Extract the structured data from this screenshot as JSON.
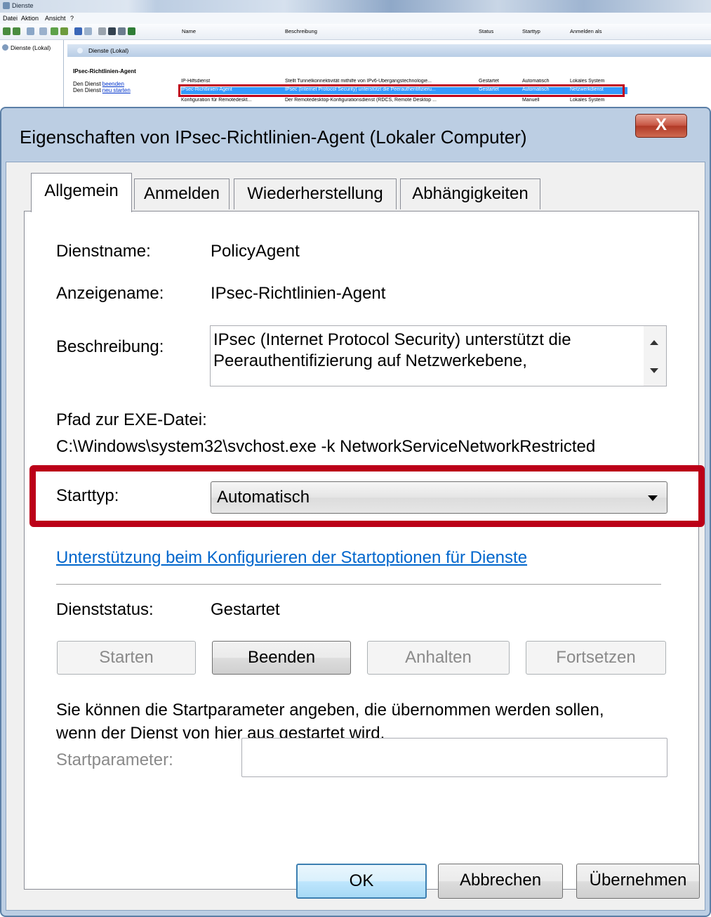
{
  "console": {
    "title": "Dienste",
    "menu": [
      "Datei",
      "Aktion",
      "Ansicht",
      "?"
    ],
    "tree_item": "Dienste (Lokal)",
    "pane_header": "Dienste (Lokal)",
    "detail": {
      "service_name": "IPsec-Richtlinien-Agent",
      "stop_prefix": "Den Dienst ",
      "stop_link": "beenden",
      "restart_prefix": "Den Dienst ",
      "restart_link": "neu starten"
    },
    "columns": [
      "Name",
      "Beschreibung",
      "Status",
      "Starttyp",
      "Anmelden als"
    ],
    "rows": [
      {
        "name": "IP-Hilfsdienst",
        "desc": "Stellt Tunnelkonnektivität mithilfe von IPv6-Übergangstechnologie...",
        "status": "Gestartet",
        "start": "Automatisch",
        "logon": "Lokales System"
      },
      {
        "name": "IPsec-Richtlinien-Agent",
        "desc": "IPsec (Internet Protocol Security) unterstützt die Peerauthentifizieru...",
        "status": "Gestartet",
        "start": "Automatisch",
        "logon": "Netzwerkdienst"
      },
      {
        "name": "Konfiguration für Remotedeskt...",
        "desc": "Der Remotedesktop-Konfigurationsdienst (RDCS, Remote Desktop ...",
        "status": "",
        "start": "Manuell",
        "logon": "Lokales System"
      }
    ]
  },
  "dialog": {
    "title": "Eigenschaften von IPsec-Richtlinien-Agent (Lokaler Computer)",
    "close_glyph": "X",
    "tabs": [
      "Allgemein",
      "Anmelden",
      "Wiederherstellung",
      "Abhängigkeiten"
    ],
    "service_name_label": "Dienstname:",
    "service_name_value": "PolicyAgent",
    "display_name_label": "Anzeigename:",
    "display_name_value": "IPsec-Richtlinien-Agent",
    "description_label": "Beschreibung:",
    "description_line1": "IPsec (Internet Protocol Security) unterstützt die",
    "description_line2": "Peerauthentifizierung auf Netzwerkebene,",
    "path_label": "Pfad zur EXE-Datei:",
    "path_value": "C:\\Windows\\system32\\svchost.exe -k NetworkServiceNetworkRestricted",
    "startup_type_label": "Starttyp:",
    "startup_type_value": "Automatisch",
    "help_link": "Unterstützung beim Konfigurieren der Startoptionen für Dienste",
    "status_label": "Dienststatus:",
    "status_value": "Gestartet",
    "buttons": {
      "start": "Starten",
      "stop": "Beenden",
      "pause": "Anhalten",
      "resume": "Fortsetzen"
    },
    "params_hint_line1": "Sie können die Startparameter angeben, die übernommen werden sollen,",
    "params_hint_line2": "wenn der Dienst von hier aus gestartet wird.",
    "params_label": "Startparameter:",
    "params_value": "",
    "footer": {
      "ok": "OK",
      "cancel": "Abbrechen",
      "apply": "Übernehmen"
    }
  },
  "colors": {
    "highlight": "#bb0018",
    "selection": "#3399ff",
    "link": "#0066cc"
  }
}
